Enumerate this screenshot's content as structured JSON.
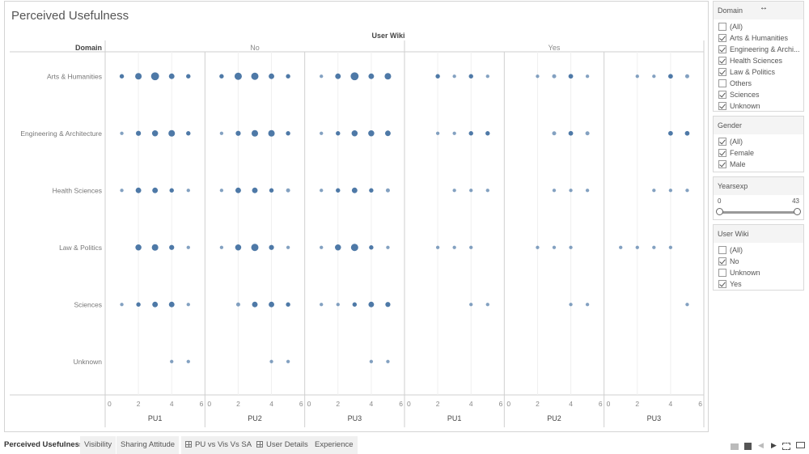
{
  "dashboard": {
    "title": "Perceived Usefulness"
  },
  "chart_data": {
    "type": "scatter",
    "title": "Perceived Usefulness",
    "column_header_title": "User Wiki",
    "row_header_title": "Domain",
    "column_groups": [
      "No",
      "Yes"
    ],
    "measures": [
      "PU1",
      "PU2",
      "PU3"
    ],
    "rows": [
      "Arts & Humanities",
      "Engineering & Architecture",
      "Health Sciences",
      "Law & Politics",
      "Sciences",
      "Unknown"
    ],
    "xlim": [
      0,
      6
    ],
    "x_ticks": [
      "0",
      "2",
      "4",
      "6"
    ],
    "mark_color": "#4e79a7",
    "size_encoding": "count (relative dot size, 1=smallest, 5=largest)",
    "points": [
      {
        "row": "Arts & Humanities",
        "group": "No",
        "measure": "PU1",
        "values": [
          [
            1,
            1
          ],
          [
            2,
            3
          ],
          [
            3,
            5
          ],
          [
            4,
            2
          ],
          [
            5,
            1
          ]
        ]
      },
      {
        "row": "Arts & Humanities",
        "group": "No",
        "measure": "PU2",
        "values": [
          [
            1,
            1
          ],
          [
            2,
            4
          ],
          [
            3,
            4
          ],
          [
            4,
            2
          ],
          [
            5,
            1
          ]
        ]
      },
      {
        "row": "Arts & Humanities",
        "group": "No",
        "measure": "PU3",
        "values": [
          [
            1,
            0.5
          ],
          [
            2,
            2
          ],
          [
            3,
            5
          ],
          [
            4,
            2
          ],
          [
            5,
            3
          ]
        ]
      },
      {
        "row": "Arts & Humanities",
        "group": "Yes",
        "measure": "PU1",
        "values": [
          [
            2,
            1
          ],
          [
            3,
            0.5
          ],
          [
            4,
            1
          ],
          [
            5,
            0.5
          ]
        ]
      },
      {
        "row": "Arts & Humanities",
        "group": "Yes",
        "measure": "PU2",
        "values": [
          [
            2,
            0.5
          ],
          [
            3,
            0.8
          ],
          [
            4,
            1.2
          ],
          [
            5,
            0.5
          ]
        ]
      },
      {
        "row": "Arts & Humanities",
        "group": "Yes",
        "measure": "PU3",
        "values": [
          [
            2,
            0.5
          ],
          [
            3,
            0.5
          ],
          [
            4,
            1.2
          ],
          [
            5,
            0.8
          ]
        ]
      },
      {
        "row": "Engineering & Architecture",
        "group": "No",
        "measure": "PU1",
        "values": [
          [
            1,
            0.5
          ],
          [
            2,
            1.5
          ],
          [
            3,
            2.5
          ],
          [
            4,
            3
          ],
          [
            5,
            1
          ]
        ]
      },
      {
        "row": "Engineering & Architecture",
        "group": "No",
        "measure": "PU2",
        "values": [
          [
            1,
            0.5
          ],
          [
            2,
            1.5
          ],
          [
            3,
            3
          ],
          [
            4,
            3
          ],
          [
            5,
            1
          ]
        ]
      },
      {
        "row": "Engineering & Architecture",
        "group": "No",
        "measure": "PU3",
        "values": [
          [
            1,
            0.5
          ],
          [
            2,
            1
          ],
          [
            3,
            2.5
          ],
          [
            4,
            2.5
          ],
          [
            5,
            2
          ]
        ]
      },
      {
        "row": "Engineering & Architecture",
        "group": "Yes",
        "measure": "PU1",
        "values": [
          [
            2,
            0.5
          ],
          [
            3,
            0.5
          ],
          [
            4,
            1
          ],
          [
            5,
            1
          ]
        ]
      },
      {
        "row": "Engineering & Architecture",
        "group": "Yes",
        "measure": "PU2",
        "values": [
          [
            3,
            0.8
          ],
          [
            4,
            1.2
          ],
          [
            5,
            0.8
          ]
        ]
      },
      {
        "row": "Engineering & Architecture",
        "group": "Yes",
        "measure": "PU3",
        "values": [
          [
            4,
            1.2
          ],
          [
            5,
            1.2
          ]
        ]
      },
      {
        "row": "Health Sciences",
        "group": "No",
        "measure": "PU1",
        "values": [
          [
            1,
            0.5
          ],
          [
            2,
            2
          ],
          [
            3,
            2
          ],
          [
            4,
            1
          ],
          [
            5,
            0.5
          ]
        ]
      },
      {
        "row": "Health Sciences",
        "group": "No",
        "measure": "PU2",
        "values": [
          [
            1,
            0.5
          ],
          [
            2,
            2
          ],
          [
            3,
            2
          ],
          [
            4,
            1
          ],
          [
            5,
            0.8
          ]
        ]
      },
      {
        "row": "Health Sciences",
        "group": "No",
        "measure": "PU3",
        "values": [
          [
            1,
            0.5
          ],
          [
            2,
            1
          ],
          [
            3,
            2
          ],
          [
            4,
            1
          ],
          [
            5,
            0.8
          ]
        ]
      },
      {
        "row": "Health Sciences",
        "group": "Yes",
        "measure": "PU1",
        "values": [
          [
            3,
            0.5
          ],
          [
            4,
            0.5
          ],
          [
            5,
            0.5
          ]
        ]
      },
      {
        "row": "Health Sciences",
        "group": "Yes",
        "measure": "PU2",
        "values": [
          [
            3,
            0.5
          ],
          [
            4,
            0.5
          ],
          [
            5,
            0.5
          ]
        ]
      },
      {
        "row": "Health Sciences",
        "group": "Yes",
        "measure": "PU3",
        "values": [
          [
            3,
            0.5
          ],
          [
            4,
            0.5
          ],
          [
            5,
            0.5
          ]
        ]
      },
      {
        "row": "Law & Politics",
        "group": "No",
        "measure": "PU1",
        "values": [
          [
            2,
            2.5
          ],
          [
            3,
            3
          ],
          [
            4,
            1.5
          ],
          [
            5,
            0.5
          ]
        ]
      },
      {
        "row": "Law & Politics",
        "group": "No",
        "measure": "PU2",
        "values": [
          [
            1,
            0.5
          ],
          [
            2,
            2.5
          ],
          [
            3,
            4
          ],
          [
            4,
            1.5
          ],
          [
            5,
            0.5
          ]
        ]
      },
      {
        "row": "Law & Politics",
        "group": "No",
        "measure": "PU3",
        "values": [
          [
            1,
            0.5
          ],
          [
            2,
            2.5
          ],
          [
            3,
            4
          ],
          [
            4,
            1
          ],
          [
            5,
            0.5
          ]
        ]
      },
      {
        "row": "Law & Politics",
        "group": "Yes",
        "measure": "PU1",
        "values": [
          [
            2,
            0.5
          ],
          [
            3,
            0.5
          ],
          [
            4,
            0.5
          ]
        ]
      },
      {
        "row": "Law & Politics",
        "group": "Yes",
        "measure": "PU2",
        "values": [
          [
            2,
            0.5
          ],
          [
            3,
            0.5
          ],
          [
            4,
            0.5
          ]
        ]
      },
      {
        "row": "Law & Politics",
        "group": "Yes",
        "measure": "PU3",
        "values": [
          [
            1,
            0.5
          ],
          [
            2,
            0.5
          ],
          [
            3,
            0.5
          ],
          [
            4,
            0.5
          ]
        ]
      },
      {
        "row": "Sciences",
        "group": "No",
        "measure": "PU1",
        "values": [
          [
            1,
            0.5
          ],
          [
            2,
            1
          ],
          [
            3,
            2
          ],
          [
            4,
            2
          ],
          [
            5,
            0.5
          ]
        ]
      },
      {
        "row": "Sciences",
        "group": "No",
        "measure": "PU2",
        "values": [
          [
            2,
            0.8
          ],
          [
            3,
            2
          ],
          [
            4,
            2
          ],
          [
            5,
            1
          ]
        ]
      },
      {
        "row": "Sciences",
        "group": "No",
        "measure": "PU3",
        "values": [
          [
            1,
            0.5
          ],
          [
            2,
            0.5
          ],
          [
            3,
            1
          ],
          [
            4,
            2
          ],
          [
            5,
            1.5
          ]
        ]
      },
      {
        "row": "Sciences",
        "group": "Yes",
        "measure": "PU1",
        "values": [
          [
            4,
            0.5
          ],
          [
            5,
            0.5
          ]
        ]
      },
      {
        "row": "Sciences",
        "group": "Yes",
        "measure": "PU2",
        "values": [
          [
            4,
            0.5
          ],
          [
            5,
            0.5
          ]
        ]
      },
      {
        "row": "Sciences",
        "group": "Yes",
        "measure": "PU3",
        "values": [
          [
            5,
            0.5
          ]
        ]
      },
      {
        "row": "Unknown",
        "group": "No",
        "measure": "PU1",
        "values": [
          [
            4,
            0.5
          ],
          [
            5,
            0.5
          ]
        ]
      },
      {
        "row": "Unknown",
        "group": "No",
        "measure": "PU2",
        "values": [
          [
            4,
            0.5
          ],
          [
            5,
            0.5
          ]
        ]
      },
      {
        "row": "Unknown",
        "group": "No",
        "measure": "PU3",
        "values": [
          [
            4,
            0.5
          ],
          [
            5,
            0.5
          ]
        ]
      }
    ]
  },
  "filters": {
    "domain": {
      "title": "Domain",
      "items": [
        {
          "label": "(All)",
          "checked": false
        },
        {
          "label": "Arts & Humanities",
          "checked": true
        },
        {
          "label": "Engineering & Archi...",
          "checked": true
        },
        {
          "label": "Health Sciences",
          "checked": true
        },
        {
          "label": "Law & Politics",
          "checked": true
        },
        {
          "label": "Others",
          "checked": false
        },
        {
          "label": "Sciences",
          "checked": true
        },
        {
          "label": "Unknown",
          "checked": true
        }
      ]
    },
    "gender": {
      "title": "Gender",
      "items": [
        {
          "label": "(All)",
          "checked": true
        },
        {
          "label": "Female",
          "checked": true
        },
        {
          "label": "Male",
          "checked": true
        }
      ]
    },
    "yearsexp": {
      "title": "Yearsexp",
      "min_label": "0",
      "max_label": "43",
      "range": [
        0,
        43
      ]
    },
    "user_wiki": {
      "title": "User Wiki",
      "items": [
        {
          "label": "(All)",
          "checked": false
        },
        {
          "label": "No",
          "checked": true
        },
        {
          "label": "Unknown",
          "checked": false
        },
        {
          "label": "Yes",
          "checked": true
        }
      ]
    }
  },
  "tabs": [
    {
      "label": "Perceived Usefulness",
      "active": true,
      "icon": null
    },
    {
      "label": "Visibility",
      "active": false,
      "icon": null
    },
    {
      "label": "Sharing Attitude",
      "active": false,
      "icon": null
    },
    {
      "label": "PU vs Vis Vs SA",
      "active": false,
      "icon": "dashboard-grid-icon"
    },
    {
      "label": "User Details",
      "active": false,
      "icon": "dashboard-grid-icon"
    },
    {
      "label": "Experience",
      "active": false,
      "icon": null
    }
  ],
  "statusbar": {
    "icons": [
      "sheet-sorter-icon",
      "filmstrip-icon",
      "prev-sheet-icon",
      "next-sheet-icon",
      "fullscreen-icon",
      "presentation-icon"
    ]
  }
}
